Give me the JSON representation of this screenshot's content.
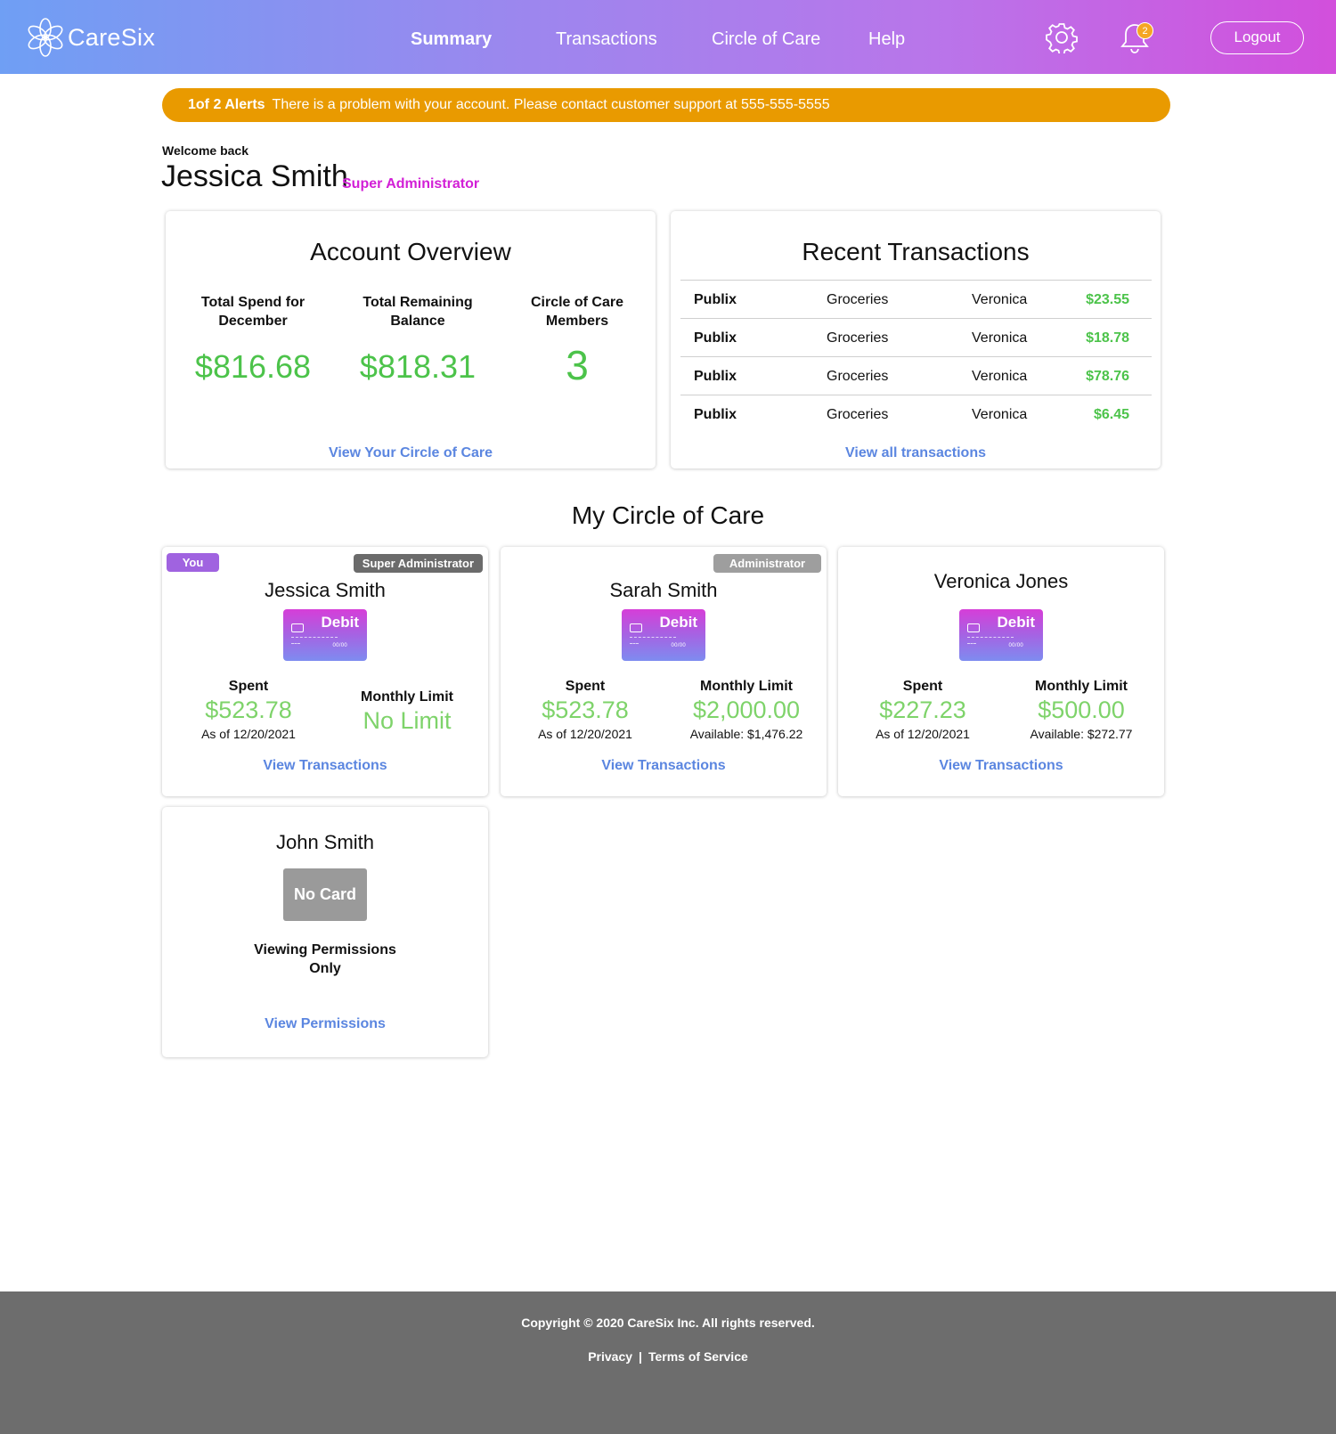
{
  "brand": {
    "name": "CareSix",
    "logo_icon": "flower-logo-icon"
  },
  "nav": {
    "items": [
      {
        "label": "Summary",
        "active": true
      },
      {
        "label": "Transactions",
        "active": false
      },
      {
        "label": "Circle of Care",
        "active": false
      },
      {
        "label": "Help",
        "active": false
      }
    ],
    "settings_icon": "gear-icon",
    "notifications_icon": "bell-icon",
    "notification_count": "2",
    "logout_label": "Logout"
  },
  "alert": {
    "counter": "1of 2 Alerts",
    "message": "There is a problem with your account. Please contact customer support at 555-555-5555",
    "color": "#e99a00"
  },
  "welcome": {
    "greeting": "Welcome back",
    "name": "Jessica Smith",
    "role": "Super Administrator"
  },
  "account_overview": {
    "title": "Account Overview",
    "stats": [
      {
        "label": "Total Spend for December",
        "value": "$816.68"
      },
      {
        "label": "Total Remaining Balance",
        "value": "$818.31"
      },
      {
        "label": "Circle of Care Members",
        "value": "3"
      }
    ],
    "link": "View Your Circle of Care"
  },
  "recent_transactions": {
    "title": "Recent Transactions",
    "rows": [
      {
        "merchant": "Publix",
        "category": "Groceries",
        "member": "Veronica",
        "amount": "$23.55"
      },
      {
        "merchant": "Publix",
        "category": "Groceries",
        "member": "Veronica",
        "amount": "$18.78"
      },
      {
        "merchant": "Publix",
        "category": "Groceries",
        "member": "Veronica",
        "amount": "$78.76"
      },
      {
        "merchant": "Publix",
        "category": "Groceries",
        "member": "Veronica",
        "amount": "$6.45"
      }
    ],
    "link": "View all transactions"
  },
  "circle": {
    "title": "My Circle of Care",
    "members": [
      {
        "you_badge": "You",
        "role": "Super Administrator",
        "name": "Jessica Smith",
        "card_label": "Debit",
        "card_expiry": "00/00",
        "spent_label": "Spent",
        "spent": "$523.78",
        "as_of": "As of 12/20/2021",
        "limit_label": "Monthly Limit",
        "limit": "No Limit",
        "available": "",
        "link": "View Transactions"
      },
      {
        "you_badge": "",
        "role": "Administrator",
        "name": "Sarah Smith",
        "card_label": "Debit",
        "card_expiry": "00/00",
        "spent_label": "Spent",
        "spent": "$523.78",
        "as_of": "As of 12/20/2021",
        "limit_label": "Monthly Limit",
        "limit": "$2,000.00",
        "available": "Available: $1,476.22",
        "link": "View Transactions"
      },
      {
        "you_badge": "",
        "role": "",
        "name": "Veronica Jones",
        "card_label": "Debit",
        "card_expiry": "00/00",
        "spent_label": "Spent",
        "spent": "$227.23",
        "as_of": "As of 12/20/2021",
        "limit_label": "Monthly Limit",
        "limit": "$500.00",
        "available": "Available: $272.77",
        "link": "View Transactions"
      },
      {
        "name": "John Smith",
        "no_card_label": "No Card",
        "permission_text": "Viewing Permissions Only",
        "link": "View Permissions"
      }
    ]
  },
  "footer": {
    "copyright": "Copyright © 2020 CareSix Inc. All rights reserved.",
    "privacy": "Privacy",
    "separator": "|",
    "terms": "Terms of Service"
  }
}
